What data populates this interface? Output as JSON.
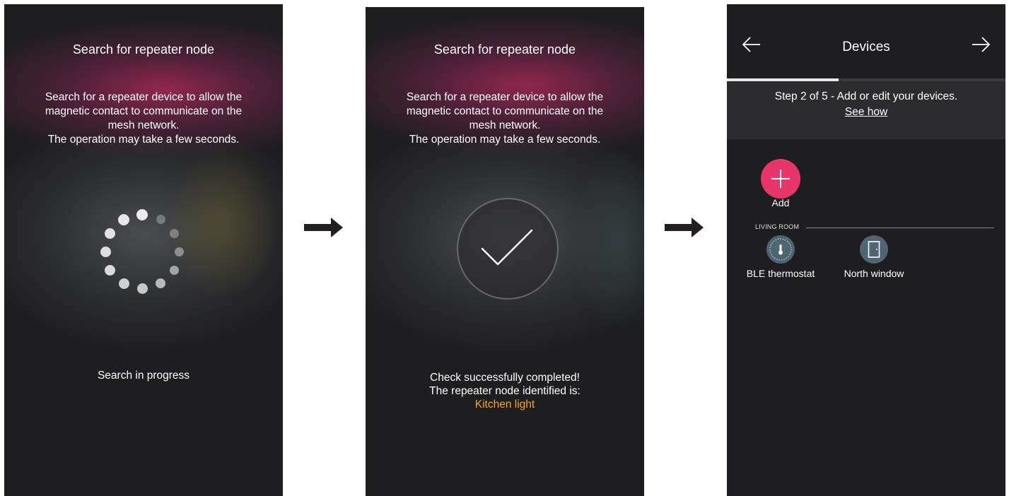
{
  "screens": [
    {
      "title": "Search for repeater node",
      "description": [
        "Search for a repeater device to allow the",
        "magnetic contact to communicate on the",
        "mesh network.",
        "The operation may take a few seconds."
      ],
      "status": "Search in progress"
    },
    {
      "title": "Search for repeater node",
      "description": [
        "Search for a repeater device to allow the",
        "magnetic contact to communicate on the",
        "mesh network.",
        "The operation may take a few seconds."
      ],
      "status_lines": [
        "Check successfully completed!",
        "The repeater node identified is:"
      ],
      "repeater_name": "Kitchen light"
    },
    {
      "title": "Devices",
      "step_text": "Step 2 of 5 - Add or edit your devices.",
      "see_how": "See how",
      "add_label": "Add",
      "section_label": "LIVING ROOM",
      "devices": [
        {
          "label": "BLE thermostat",
          "icon": "thermostat-icon"
        },
        {
          "label": "North window",
          "icon": "window-contact-icon"
        }
      ],
      "progress": 0.4
    }
  ],
  "colors": {
    "accent": "#f5a623",
    "add_button": "#e8356a",
    "background": "#1e1e20",
    "device_icon": "#4e6672"
  }
}
